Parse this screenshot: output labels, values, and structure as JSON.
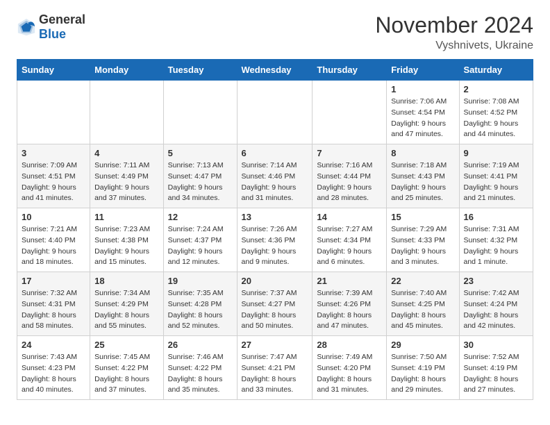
{
  "header": {
    "logo": {
      "general": "General",
      "blue": "Blue"
    },
    "month_title": "November 2024",
    "location": "Vyshnivets, Ukraine"
  },
  "calendar": {
    "headers": [
      "Sunday",
      "Monday",
      "Tuesday",
      "Wednesday",
      "Thursday",
      "Friday",
      "Saturday"
    ],
    "weeks": [
      [
        {
          "day": "",
          "info": ""
        },
        {
          "day": "",
          "info": ""
        },
        {
          "day": "",
          "info": ""
        },
        {
          "day": "",
          "info": ""
        },
        {
          "day": "",
          "info": ""
        },
        {
          "day": "1",
          "info": "Sunrise: 7:06 AM\nSunset: 4:54 PM\nDaylight: 9 hours and 47 minutes."
        },
        {
          "day": "2",
          "info": "Sunrise: 7:08 AM\nSunset: 4:52 PM\nDaylight: 9 hours and 44 minutes."
        }
      ],
      [
        {
          "day": "3",
          "info": "Sunrise: 7:09 AM\nSunset: 4:51 PM\nDaylight: 9 hours and 41 minutes."
        },
        {
          "day": "4",
          "info": "Sunrise: 7:11 AM\nSunset: 4:49 PM\nDaylight: 9 hours and 37 minutes."
        },
        {
          "day": "5",
          "info": "Sunrise: 7:13 AM\nSunset: 4:47 PM\nDaylight: 9 hours and 34 minutes."
        },
        {
          "day": "6",
          "info": "Sunrise: 7:14 AM\nSunset: 4:46 PM\nDaylight: 9 hours and 31 minutes."
        },
        {
          "day": "7",
          "info": "Sunrise: 7:16 AM\nSunset: 4:44 PM\nDaylight: 9 hours and 28 minutes."
        },
        {
          "day": "8",
          "info": "Sunrise: 7:18 AM\nSunset: 4:43 PM\nDaylight: 9 hours and 25 minutes."
        },
        {
          "day": "9",
          "info": "Sunrise: 7:19 AM\nSunset: 4:41 PM\nDaylight: 9 hours and 21 minutes."
        }
      ],
      [
        {
          "day": "10",
          "info": "Sunrise: 7:21 AM\nSunset: 4:40 PM\nDaylight: 9 hours and 18 minutes."
        },
        {
          "day": "11",
          "info": "Sunrise: 7:23 AM\nSunset: 4:38 PM\nDaylight: 9 hours and 15 minutes."
        },
        {
          "day": "12",
          "info": "Sunrise: 7:24 AM\nSunset: 4:37 PM\nDaylight: 9 hours and 12 minutes."
        },
        {
          "day": "13",
          "info": "Sunrise: 7:26 AM\nSunset: 4:36 PM\nDaylight: 9 hours and 9 minutes."
        },
        {
          "day": "14",
          "info": "Sunrise: 7:27 AM\nSunset: 4:34 PM\nDaylight: 9 hours and 6 minutes."
        },
        {
          "day": "15",
          "info": "Sunrise: 7:29 AM\nSunset: 4:33 PM\nDaylight: 9 hours and 3 minutes."
        },
        {
          "day": "16",
          "info": "Sunrise: 7:31 AM\nSunset: 4:32 PM\nDaylight: 9 hours and 1 minute."
        }
      ],
      [
        {
          "day": "17",
          "info": "Sunrise: 7:32 AM\nSunset: 4:31 PM\nDaylight: 8 hours and 58 minutes."
        },
        {
          "day": "18",
          "info": "Sunrise: 7:34 AM\nSunset: 4:29 PM\nDaylight: 8 hours and 55 minutes."
        },
        {
          "day": "19",
          "info": "Sunrise: 7:35 AM\nSunset: 4:28 PM\nDaylight: 8 hours and 52 minutes."
        },
        {
          "day": "20",
          "info": "Sunrise: 7:37 AM\nSunset: 4:27 PM\nDaylight: 8 hours and 50 minutes."
        },
        {
          "day": "21",
          "info": "Sunrise: 7:39 AM\nSunset: 4:26 PM\nDaylight: 8 hours and 47 minutes."
        },
        {
          "day": "22",
          "info": "Sunrise: 7:40 AM\nSunset: 4:25 PM\nDaylight: 8 hours and 45 minutes."
        },
        {
          "day": "23",
          "info": "Sunrise: 7:42 AM\nSunset: 4:24 PM\nDaylight: 8 hours and 42 minutes."
        }
      ],
      [
        {
          "day": "24",
          "info": "Sunrise: 7:43 AM\nSunset: 4:23 PM\nDaylight: 8 hours and 40 minutes."
        },
        {
          "day": "25",
          "info": "Sunrise: 7:45 AM\nSunset: 4:22 PM\nDaylight: 8 hours and 37 minutes."
        },
        {
          "day": "26",
          "info": "Sunrise: 7:46 AM\nSunset: 4:22 PM\nDaylight: 8 hours and 35 minutes."
        },
        {
          "day": "27",
          "info": "Sunrise: 7:47 AM\nSunset: 4:21 PM\nDaylight: 8 hours and 33 minutes."
        },
        {
          "day": "28",
          "info": "Sunrise: 7:49 AM\nSunset: 4:20 PM\nDaylight: 8 hours and 31 minutes."
        },
        {
          "day": "29",
          "info": "Sunrise: 7:50 AM\nSunset: 4:19 PM\nDaylight: 8 hours and 29 minutes."
        },
        {
          "day": "30",
          "info": "Sunrise: 7:52 AM\nSunset: 4:19 PM\nDaylight: 8 hours and 27 minutes."
        }
      ]
    ]
  }
}
